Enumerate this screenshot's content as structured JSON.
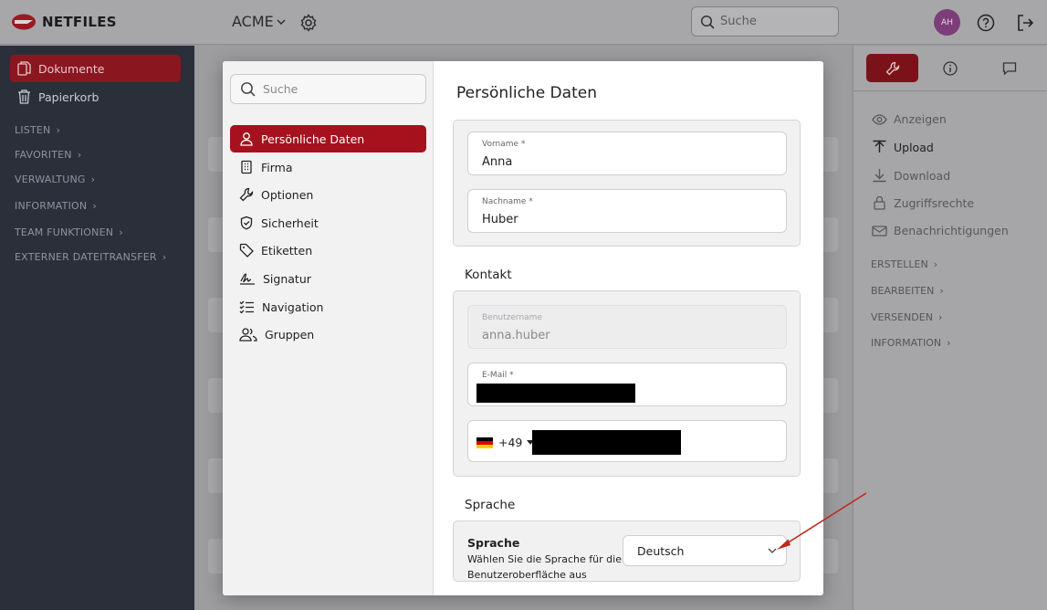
{
  "app": {
    "brand": "NETFILES",
    "workspace": "ACME"
  },
  "topbar": {
    "search_placeholder": "Suche",
    "avatar_initials": "AH"
  },
  "sidebar": {
    "items": [
      {
        "label": "Dokumente",
        "icon": "documents-icon",
        "active": true
      },
      {
        "label": "Papierkorb",
        "icon": "trash-icon"
      }
    ],
    "sections": [
      "LISTEN",
      "FAVORITEN",
      "VERWALTUNG",
      "INFORMATION",
      "TEAM FUNKTIONEN",
      "EXTERNER DATEITRANSFER"
    ]
  },
  "right_panel": {
    "actions": [
      {
        "label": "Anzeigen",
        "icon": "eye-icon"
      },
      {
        "label": "Upload",
        "icon": "upload-icon"
      },
      {
        "label": "Download",
        "icon": "download-icon"
      },
      {
        "label": "Zugriffsrechte",
        "icon": "lock-icon"
      },
      {
        "label": "Benachrichtigungen",
        "icon": "mail-icon"
      }
    ],
    "sections": [
      "ERSTELLEN",
      "BEARBEITEN",
      "VERSENDEN",
      "INFORMATION"
    ]
  },
  "modal": {
    "search_placeholder": "Suche",
    "title": "Persönliche Daten",
    "nav": [
      {
        "label": "Persönliche Daten",
        "icon": "user-icon",
        "active": true
      },
      {
        "label": "Firma",
        "icon": "building-icon"
      },
      {
        "label": "Optionen",
        "icon": "wrench-icon"
      },
      {
        "label": "Sicherheit",
        "icon": "shield-icon"
      },
      {
        "label": "Etiketten",
        "icon": "tag-icon"
      },
      {
        "label": "Signatur",
        "icon": "signature-icon"
      },
      {
        "label": "Navigation",
        "icon": "list-icon"
      },
      {
        "label": "Gruppen",
        "icon": "users-icon"
      }
    ],
    "personal": {
      "firstname_label": "Vorname *",
      "firstname_value": "Anna",
      "lastname_label": "Nachname *",
      "lastname_value": "Huber"
    },
    "contact": {
      "heading": "Kontakt",
      "username_label": "Benutzername",
      "username_value": "anna.huber",
      "email_label": "E-Mail *",
      "phone_prefix": "+49"
    },
    "language": {
      "heading": "Sprache",
      "title": "Sprache",
      "description": "Wählen Sie die Sprache für die Benutzeroberfläche aus",
      "selected": "Deutsch"
    }
  },
  "colors": {
    "accent": "#a5121d",
    "sidebar_bg": "#2a2f3a",
    "annotation_arrow": "#c0281c"
  }
}
